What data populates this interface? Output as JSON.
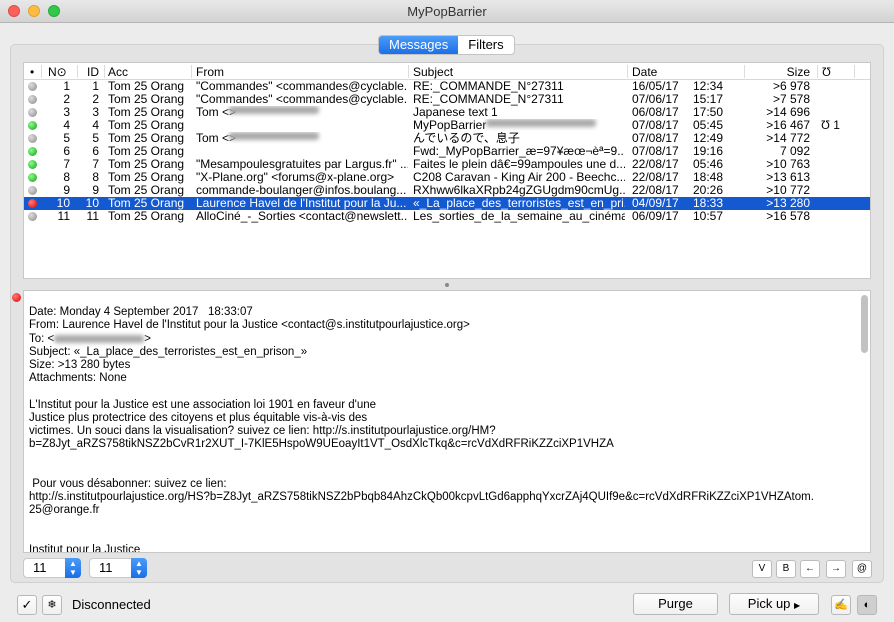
{
  "window": {
    "title": "MyPopBarrier"
  },
  "tabs": [
    {
      "label": "Messages",
      "active": true
    },
    {
      "label": "Filters",
      "active": false
    }
  ],
  "table": {
    "headers": {
      "status": "•",
      "no": "N⊙",
      "id": "ID",
      "acc": "Acc",
      "from": "From",
      "subject": "Subject",
      "date": "Date",
      "size": "Size",
      "attach": "Ʊ"
    },
    "rows": [
      {
        "status": "gray",
        "no": "1",
        "id": "1",
        "acc": "Tom 25 Orang",
        "from": "\"Commandes\" <commandes@cyclable...",
        "subject": "RE:_COMMANDE_N°27311",
        "date": "16/05/17",
        "time": "12:34",
        "size": ">6 978",
        "attach": ""
      },
      {
        "status": "gray",
        "no": "2",
        "id": "2",
        "acc": "Tom 25 Orang",
        "from": "\"Commandes\" <commandes@cyclable...",
        "subject": "RE:_COMMANDE_N°27311",
        "date": "07/06/17",
        "time": "15:17",
        "size": ">7 578",
        "attach": ""
      },
      {
        "status": "gray",
        "no": "3",
        "id": "3",
        "acc": "Tom 25 Orang",
        "from": "Tom <",
        "from_blur": true,
        "from_end": ">",
        "subject": "Japanese text 1",
        "date": "06/08/17",
        "time": "17:50",
        "size": ">14 696",
        "attach": ""
      },
      {
        "status": "green",
        "no": "4",
        "id": "4",
        "acc": "Tom 25 Orang",
        "from": "",
        "from_blur": true,
        "subject": "MyPopBarrier",
        "subject_blur": true,
        "date": "07/08/17",
        "time": "05:45",
        "size": ">16 467",
        "attach": "Ʊ 1"
      },
      {
        "status": "gray",
        "no": "5",
        "id": "5",
        "acc": "Tom 25 Orang",
        "from": "Tom <",
        "from_blur": true,
        "from_end": ">",
        "subject": "んでいるので、息子",
        "date": "07/08/17",
        "time": "12:49",
        "size": ">14 772",
        "attach": ""
      },
      {
        "status": "green",
        "no": "6",
        "id": "6",
        "acc": "Tom 25 Orang",
        "from": "",
        "from_blur": true,
        "subject": "Fwd:_MyPopBarrier_æ=97¥æœ¬èª=9...",
        "date": "07/08/17",
        "time": "19:16",
        "size": "7 092",
        "attach": ""
      },
      {
        "status": "green",
        "no": "7",
        "id": "7",
        "acc": "Tom 25 Orang",
        "from": "\"Mesampoulesgratuites par Largus.fr\" ...",
        "subject": "Faites le plein dâ€=99ampoules une d...",
        "date": "22/08/17",
        "time": "05:46",
        "size": ">10 763",
        "attach": ""
      },
      {
        "status": "green",
        "no": "8",
        "id": "8",
        "acc": "Tom 25 Orang",
        "from": "\"X-Plane.org\" <forums@x-plane.org>",
        "subject": "C208 Caravan - King Air 200 - Beechc...",
        "date": "22/08/17",
        "time": "18:48",
        "size": ">13 613",
        "attach": ""
      },
      {
        "status": "gray",
        "no": "9",
        "id": "9",
        "acc": "Tom 25 Orang",
        "from": "commande-boulanger@infos.boulang...",
        "subject": "RXhww6lkaXRpb24gZGUgdm90cmUg...",
        "date": "22/08/17",
        "time": "20:26",
        "size": ">10 772",
        "attach": ""
      },
      {
        "status": "red",
        "selected": true,
        "no": "10",
        "id": "10",
        "acc": "Tom 25 Orang",
        "from": "Laurence Havel de l'Institut pour la Ju...",
        "subject": "«_La_place_des_terroristes_est_en_pri...",
        "date": "04/09/17",
        "time": "18:33",
        "size": ">13 280",
        "attach": ""
      },
      {
        "status": "gray",
        "no": "11",
        "id": "11",
        "acc": "Tom 25 Orang",
        "from": "AlloCiné_-_Sorties <contact@newslett...",
        "subject": "Les_sorties_de_la_semaine_au_cinéma",
        "date": "06/09/17",
        "time": "10:57",
        "size": ">16 578",
        "attach": ""
      }
    ]
  },
  "message": {
    "status": "red",
    "date": "Date: Monday 4 September 2017   18:33:07",
    "from": "From: Laurence Havel de l'Institut pour la Justice <contact@s.institutpourlajustice.org>",
    "to_prefix": "To: <",
    "to_suffix": ">",
    "subject": "Subject: «_La_place_des_terroristes_est_en_prison_»",
    "size": "Size: >13 280 bytes",
    "attachments": "Attachments: None",
    "body1": "L'Institut pour la Justice est une association loi 1901 en faveur d'une\nJustice plus protectrice des citoyens et plus équitable vis-à-vis des\nvictimes. Un souci dans la visualisation? suivez ce lien: http://s.institutpourlajustice.org/HM?\nb=Z8Jyt_aRZS758tikNSZ2bCvR1r2XUT_I-7KlE5HspoW9UEoayIt1VT_OsdXlcTkq&c=rcVdXdRFRiKZZciXP1VHZA",
    "body2": " Pour vous désabonner: suivez ce lien:\nhttp://s.institutpourlajustice.org/HS?b=Z8Jyt_aRZS758tikNSZ2bPbqb84AhzCkQb00kcpvLtGd6apphqYxcrZAj4QUIf9e&c=rcVdXdRFRiKZZciXP1VHZAtom.\n25@orange.fr",
    "body3": "Institut pour la Justice"
  },
  "controls": {
    "stepper1": "11",
    "stepper2": "11",
    "btn_v": "V",
    "btn_b": "B",
    "btn_prev": "←",
    "btn_next": "→",
    "btn_at": "@"
  },
  "footer": {
    "check": "✓",
    "snow": "❄",
    "status": "Disconnected",
    "purge": "Purge",
    "pickup": "Pick up"
  },
  "colors": {
    "selection": "#1559d0",
    "accent": "#1a6fe8",
    "green": "#2db52d",
    "red": "#e0141c",
    "gray": "#a8a8a8"
  }
}
